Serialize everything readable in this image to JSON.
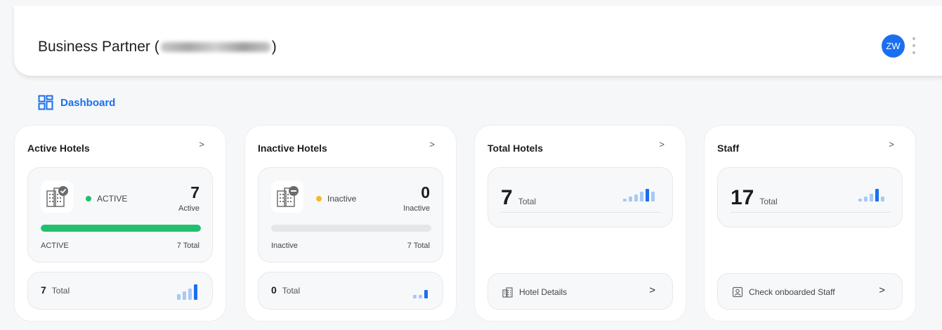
{
  "header": {
    "title_prefix": "Business Partner (",
    "title_suffix": ")",
    "avatar_initials": "ZW"
  },
  "breadcrumb": {
    "label": "Dashboard"
  },
  "cards": {
    "active": {
      "title": "Active Hotels",
      "chevron": ">",
      "status": "ACTIVE",
      "count": "7",
      "count_label": "Active",
      "progress": 1.0,
      "bar_left": "ACTIVE",
      "bar_right": "7 Total",
      "total_num": "7",
      "total_label": "Total"
    },
    "inactive": {
      "title": "Inactive Hotels",
      "chevron": ">",
      "status": "Inactive",
      "count": "0",
      "count_label": "Inactive",
      "progress": 0.0,
      "bar_left": "Inactive",
      "bar_right": "7 Total",
      "total_num": "0",
      "total_label": "Total"
    },
    "total": {
      "title": "Total Hotels",
      "chevron": ">",
      "total_num": "7",
      "total_label": "Total",
      "footer_label": "Hotel Details",
      "footer_arrow": ">"
    },
    "staff": {
      "title": "Staff",
      "chevron": ">",
      "total_num": "17",
      "total_label": "Total",
      "footer_label": "Check onboarded Staff",
      "footer_arrow": ">"
    }
  },
  "colors": {
    "accent": "#1a6ff0",
    "active_green": "#21c06e",
    "inactive_amber": "#f5b82e",
    "bar_light": "#a8c9f5",
    "bar_dark": "#1a6ff0"
  }
}
